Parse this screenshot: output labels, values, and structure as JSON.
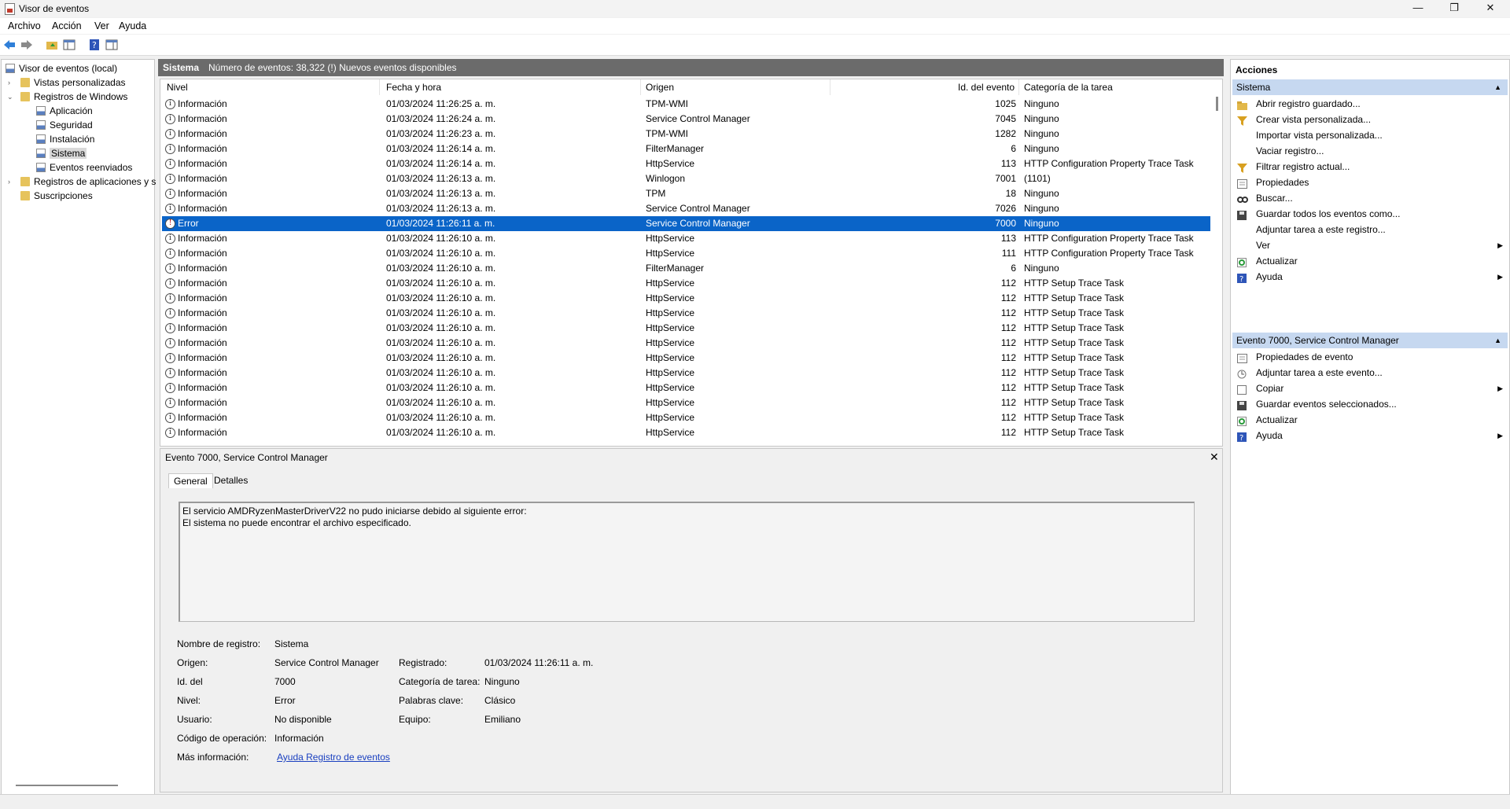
{
  "window": {
    "title": "Visor de eventos",
    "minimize": "—",
    "maximize": "❐",
    "close": "✕"
  },
  "menu": [
    "Archivo",
    "Acción",
    "Ver",
    "Ayuda"
  ],
  "toolbar": {
    "icons": [
      "back-icon",
      "forward-icon",
      "folder-up-icon",
      "show-hide-tree-icon",
      "help-icon",
      "show-hide-actions-icon"
    ]
  },
  "tree": {
    "root": "Visor de eventos (local)",
    "custom_views": "Vistas personalizadas",
    "windows_logs": "Registros de Windows",
    "logs": [
      "Aplicación",
      "Seguridad",
      "Instalación",
      "Sistema",
      "Eventos reenviados"
    ],
    "app_services_logs": "Registros de aplicaciones y s",
    "subscriptions": "Suscripciones",
    "selected": "Sistema"
  },
  "center_header": {
    "title": "Sistema",
    "info": "Número de eventos: 38,322 (!) Nuevos eventos disponibles"
  },
  "columns": [
    "Nivel",
    "Fecha y hora",
    "Origen",
    "Id. del evento",
    "Categoría de la tarea"
  ],
  "events": [
    {
      "level": "Información",
      "date": "01/03/2024 11:26:25 a. m.",
      "source": "TPM-WMI",
      "id": "1025",
      "category": "Ninguno"
    },
    {
      "level": "Información",
      "date": "01/03/2024 11:26:24 a. m.",
      "source": "Service Control Manager",
      "id": "7045",
      "category": "Ninguno"
    },
    {
      "level": "Información",
      "date": "01/03/2024 11:26:23 a. m.",
      "source": "TPM-WMI",
      "id": "1282",
      "category": "Ninguno"
    },
    {
      "level": "Información",
      "date": "01/03/2024 11:26:14 a. m.",
      "source": "FilterManager",
      "id": "6",
      "category": "Ninguno"
    },
    {
      "level": "Información",
      "date": "01/03/2024 11:26:14 a. m.",
      "source": "HttpService",
      "id": "113",
      "category": "HTTP Configuration Property Trace Task"
    },
    {
      "level": "Información",
      "date": "01/03/2024 11:26:13 a. m.",
      "source": "Winlogon",
      "id": "7001",
      "category": "(1101)"
    },
    {
      "level": "Información",
      "date": "01/03/2024 11:26:13 a. m.",
      "source": "TPM",
      "id": "18",
      "category": "Ninguno"
    },
    {
      "level": "Información",
      "date": "01/03/2024 11:26:13 a. m.",
      "source": "Service Control Manager",
      "id": "7026",
      "category": "Ninguno"
    },
    {
      "level": "Error",
      "date": "01/03/2024 11:26:11 a. m.",
      "source": "Service Control Manager",
      "id": "7000",
      "category": "Ninguno"
    },
    {
      "level": "Información",
      "date": "01/03/2024 11:26:10 a. m.",
      "source": "HttpService",
      "id": "113",
      "category": "HTTP Configuration Property Trace Task"
    },
    {
      "level": "Información",
      "date": "01/03/2024 11:26:10 a. m.",
      "source": "HttpService",
      "id": "111",
      "category": "HTTP Configuration Property Trace Task"
    },
    {
      "level": "Información",
      "date": "01/03/2024 11:26:10 a. m.",
      "source": "FilterManager",
      "id": "6",
      "category": "Ninguno"
    },
    {
      "level": "Información",
      "date": "01/03/2024 11:26:10 a. m.",
      "source": "HttpService",
      "id": "112",
      "category": "HTTP Setup Trace Task"
    },
    {
      "level": "Información",
      "date": "01/03/2024 11:26:10 a. m.",
      "source": "HttpService",
      "id": "112",
      "category": "HTTP Setup Trace Task"
    },
    {
      "level": "Información",
      "date": "01/03/2024 11:26:10 a. m.",
      "source": "HttpService",
      "id": "112",
      "category": "HTTP Setup Trace Task"
    },
    {
      "level": "Información",
      "date": "01/03/2024 11:26:10 a. m.",
      "source": "HttpService",
      "id": "112",
      "category": "HTTP Setup Trace Task"
    },
    {
      "level": "Información",
      "date": "01/03/2024 11:26:10 a. m.",
      "source": "HttpService",
      "id": "112",
      "category": "HTTP Setup Trace Task"
    },
    {
      "level": "Información",
      "date": "01/03/2024 11:26:10 a. m.",
      "source": "HttpService",
      "id": "112",
      "category": "HTTP Setup Trace Task"
    },
    {
      "level": "Información",
      "date": "01/03/2024 11:26:10 a. m.",
      "source": "HttpService",
      "id": "112",
      "category": "HTTP Setup Trace Task"
    },
    {
      "level": "Información",
      "date": "01/03/2024 11:26:10 a. m.",
      "source": "HttpService",
      "id": "112",
      "category": "HTTP Setup Trace Task"
    },
    {
      "level": "Información",
      "date": "01/03/2024 11:26:10 a. m.",
      "source": "HttpService",
      "id": "112",
      "category": "HTTP Setup Trace Task"
    },
    {
      "level": "Información",
      "date": "01/03/2024 11:26:10 a. m.",
      "source": "HttpService",
      "id": "112",
      "category": "HTTP Setup Trace Task"
    },
    {
      "level": "Información",
      "date": "01/03/2024 11:26:10 a. m.",
      "source": "HttpService",
      "id": "112",
      "category": "HTTP Setup Trace Task"
    }
  ],
  "selected_event_index": 8,
  "detail": {
    "title": "Evento 7000, Service Control Manager",
    "tabs": [
      "General",
      "Detalles"
    ],
    "description_line1": "El servicio AMDRyzenMasterDriverV22 no pudo iniciarse debido al siguiente error:",
    "description_line2": "El sistema no puede encontrar el archivo especificado.",
    "labels": {
      "log_name": "Nombre de registro:",
      "source": "Origen:",
      "event_id": "Id. del",
      "level": "Nivel:",
      "user": "Usuario:",
      "opcode": "Código de operación:",
      "more_info": "Más información:",
      "logged": "Registrado:",
      "task_category": "Categoría de tarea:",
      "keywords": "Palabras clave:",
      "computer": "Equipo:"
    },
    "values": {
      "log_name": "Sistema",
      "source": "Service Control Manager",
      "event_id": "7000",
      "level": "Error",
      "user": "No disponible",
      "opcode": "Información",
      "more_info_link": "Ayuda Registro de eventos",
      "logged": "01/03/2024 11:26:11 a. m.",
      "task_category": "Ninguno",
      "keywords": "Clásico",
      "computer": "Emiliano"
    }
  },
  "actions": {
    "title": "Acciones",
    "section1": "Sistema",
    "section1_items": [
      {
        "label": "Abrir registro guardado...",
        "icon": "open-log-icon"
      },
      {
        "label": "Crear vista personalizada...",
        "icon": "filter-icon"
      },
      {
        "label": "Importar vista personalizada...",
        "icon": ""
      },
      {
        "label": "Vaciar registro...",
        "icon": ""
      },
      {
        "label": "Filtrar registro actual...",
        "icon": "filter-icon"
      },
      {
        "label": "Propiedades",
        "icon": "properties-icon"
      },
      {
        "label": "Buscar...",
        "icon": "find-icon"
      },
      {
        "label": "Guardar todos los eventos como...",
        "icon": "save-icon"
      },
      {
        "label": "Adjuntar tarea a este registro...",
        "icon": ""
      },
      {
        "label": "Ver",
        "icon": "",
        "submenu": true
      },
      {
        "label": "Actualizar",
        "icon": "refresh-icon"
      },
      {
        "label": "Ayuda",
        "icon": "help-icon",
        "submenu": true
      }
    ],
    "section2": "Evento 7000, Service Control Manager",
    "section2_items": [
      {
        "label": "Propiedades de evento",
        "icon": "properties-icon"
      },
      {
        "label": "Adjuntar tarea a este evento...",
        "icon": "task-icon"
      },
      {
        "label": "Copiar",
        "icon": "copy-icon",
        "submenu": true
      },
      {
        "label": "Guardar eventos seleccionados...",
        "icon": "save-icon"
      },
      {
        "label": "Actualizar",
        "icon": "refresh-icon"
      },
      {
        "label": "Ayuda",
        "icon": "help-icon",
        "submenu": true
      }
    ]
  },
  "colors": {
    "selection": "#0a64c8",
    "section_header": "#c6d8f0",
    "center_header": "#6b6b6b",
    "link": "#1a40c0"
  }
}
